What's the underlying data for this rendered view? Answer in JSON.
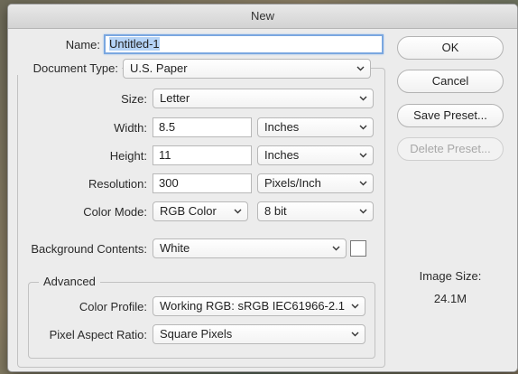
{
  "dialog": {
    "title": "New"
  },
  "name": {
    "label": "Name:",
    "value": "Untitled-1"
  },
  "document_type": {
    "label": "Document Type:",
    "value": "U.S. Paper"
  },
  "size": {
    "label": "Size:",
    "value": "Letter"
  },
  "width": {
    "label": "Width:",
    "value": "8.5",
    "unit": "Inches"
  },
  "height": {
    "label": "Height:",
    "value": "11",
    "unit": "Inches"
  },
  "resolution": {
    "label": "Resolution:",
    "value": "300",
    "unit": "Pixels/Inch"
  },
  "color_mode": {
    "label": "Color Mode:",
    "value": "RGB Color",
    "depth": "8 bit"
  },
  "background": {
    "label": "Background Contents:",
    "value": "White",
    "swatch_color": "#ffffff"
  },
  "advanced": {
    "title": "Advanced",
    "color_profile": {
      "label": "Color Profile:",
      "value": "Working RGB:  sRGB IEC61966-2.1"
    },
    "pixel_aspect": {
      "label": "Pixel Aspect Ratio:",
      "value": "Square Pixels"
    }
  },
  "buttons": {
    "ok": "OK",
    "cancel": "Cancel",
    "save_preset": "Save Preset...",
    "delete_preset": "Delete Preset..."
  },
  "image_size": {
    "label": "Image Size:",
    "value": "24.1M"
  }
}
